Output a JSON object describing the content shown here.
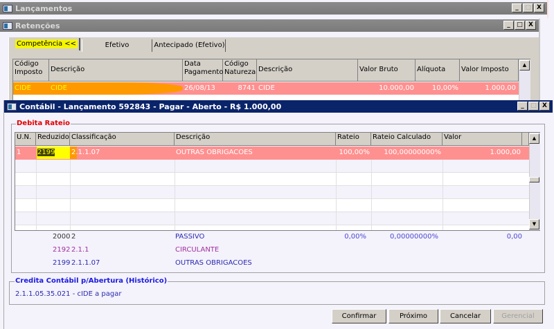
{
  "windows": {
    "lancamentos": {
      "title": "Lançamentos"
    },
    "retencoes": {
      "title": "Retenções",
      "tabs": [
        {
          "label": "Competência <<",
          "active": true
        },
        {
          "label": "Efetivo"
        },
        {
          "label": "Antecipado (Efetivo)"
        }
      ],
      "columns": [
        "Código Imposto",
        "Descrição",
        "Data Pagamento",
        "Código Natureza",
        "Descrição",
        "Valor Bruto",
        "Alíquota",
        "Valor Imposto"
      ],
      "rows": [
        [
          "CIDE",
          "CIDE",
          "26/08/13",
          "8741",
          "CIDE",
          "10.000,00",
          "10,00%",
          "1.000,00"
        ]
      ]
    },
    "contabil": {
      "title": "Contábil - Lançamento 592843 - Pagar - Aberto - R$ 1.000,00",
      "debita": {
        "label": "Debita Rateio",
        "columns": [
          "U.N.",
          "Reduzido",
          "Classificação",
          "Descrição",
          "Rateio",
          "Rateio Calculado",
          "Valor"
        ],
        "rows": [
          [
            "1",
            "2199",
            "2.1.1.07",
            "OUTRAS OBRIGACOES",
            "100,00%",
            "100,00000000%",
            "1.000,00"
          ]
        ],
        "totals": {
          "reduzido": "2000",
          "classificacao": "2",
          "descricao": "PASSIVO",
          "rateio": "0,00%",
          "rateio_calculado": "0,00000000%",
          "valor": "0,00"
        },
        "hierarchy": [
          {
            "reduzido": "2192",
            "classificacao": "2.1.1",
            "descricao": "CIRCULANTE"
          },
          {
            "reduzido": "2199",
            "classificacao": "2.1.1.07",
            "descricao": "OUTRAS OBRIGACOES"
          }
        ]
      },
      "credita": {
        "label": "Credita Contábil p/Abertura (Histórico)",
        "value": "2.1.1.05.35.021 - cIDE a pagar"
      },
      "buttons": {
        "confirmar": "Confirmar",
        "proximo": "Próximo",
        "cancelar": "Cancelar",
        "gerencial": "Gerencial"
      }
    }
  },
  "controls": {
    "minimize": "_",
    "maximize": "□",
    "close": "X"
  },
  "colors": {
    "selected_row": "#ff9090",
    "active_title": "#0a246a",
    "highlight_yellow": "#ffff00",
    "highlight_orange": "#ff9900"
  }
}
